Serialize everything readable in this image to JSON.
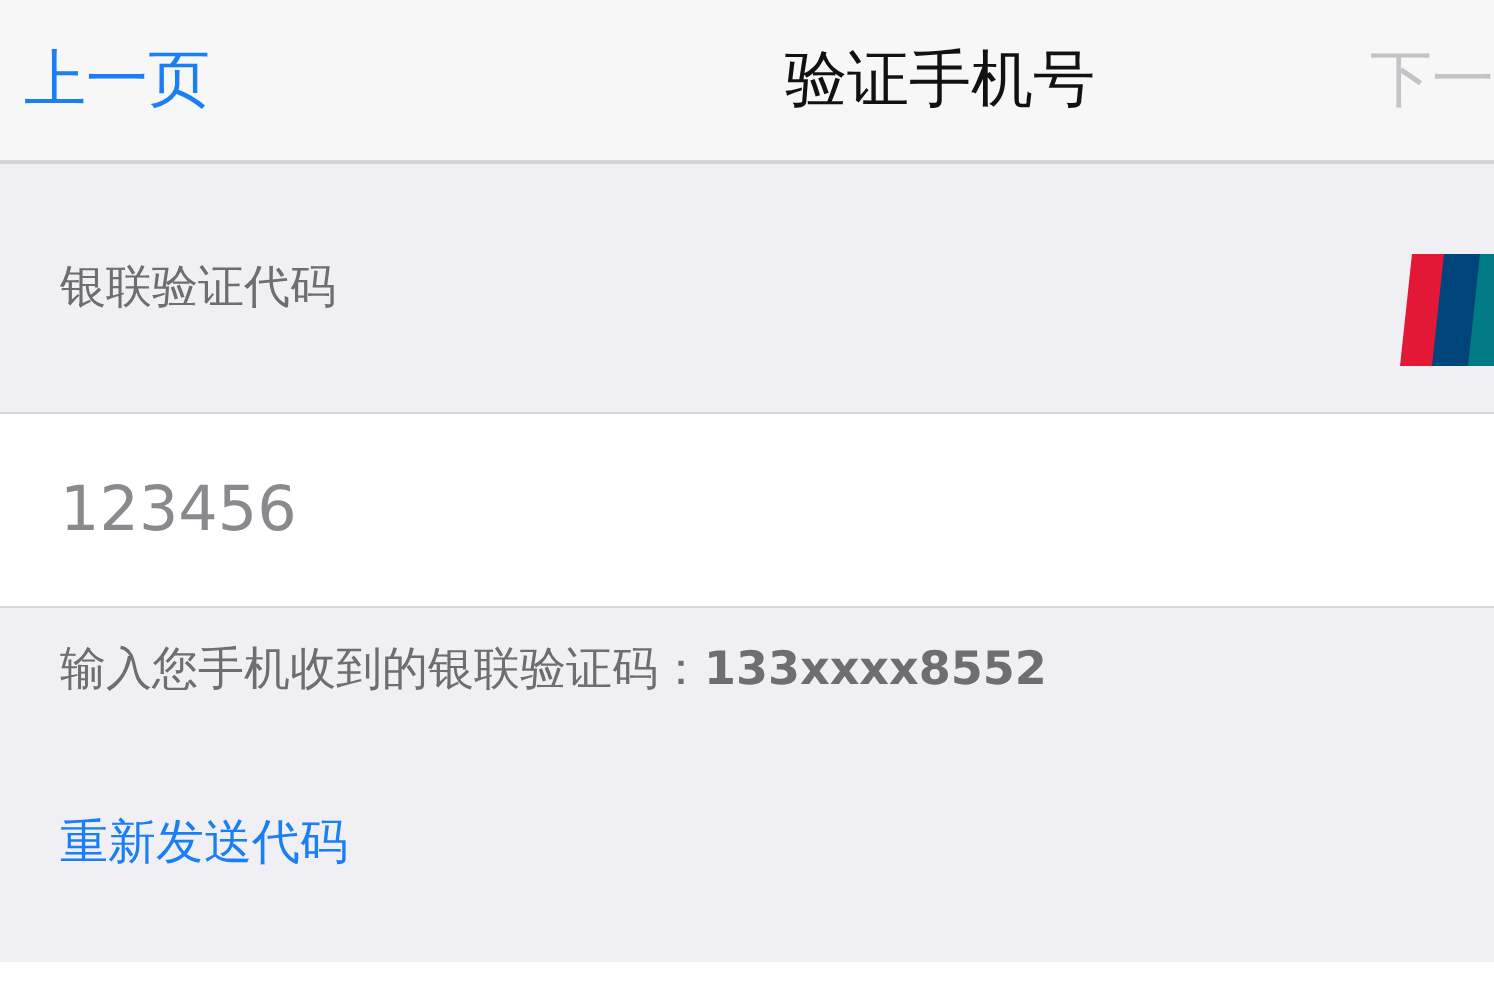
{
  "nav_bar": {
    "back": "上一页",
    "title": "验证手机号",
    "next": "下一",
    "next_disabled": true
  },
  "section": {
    "header": "银联验证代码",
    "field": {
      "placeholder": "123456"
    },
    "footer": "输入您手机收到的银联验证码：**133xxxx8552**"
  },
  "resend_link": "重新发送代码"
}
